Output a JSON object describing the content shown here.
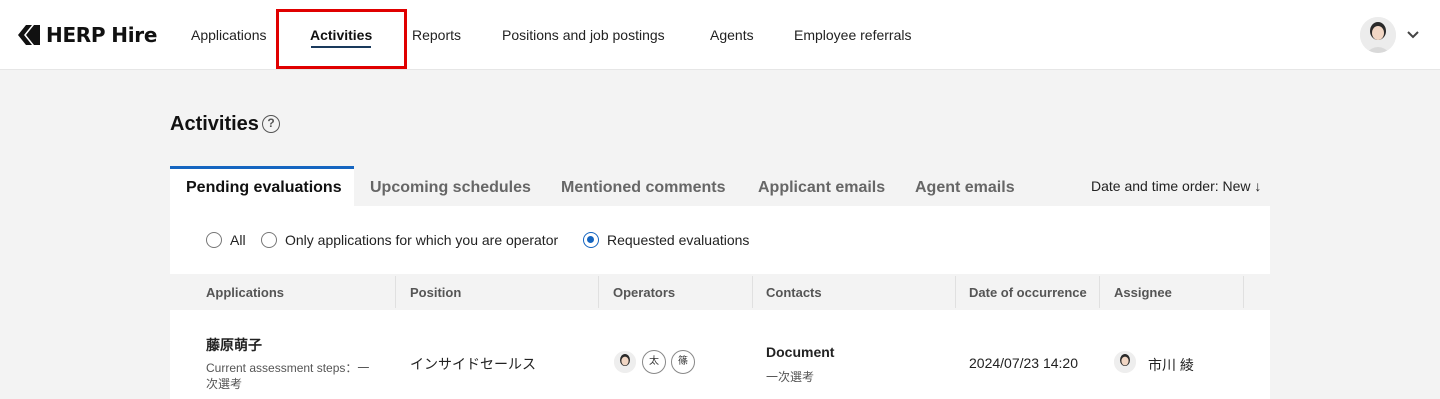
{
  "brand": {
    "name": "HERP",
    "product": "Hire"
  },
  "nav": {
    "items": [
      {
        "label": "Applications"
      },
      {
        "label": "Activities"
      },
      {
        "label": "Reports"
      },
      {
        "label": "Positions and job postings"
      },
      {
        "label": "Agents"
      },
      {
        "label": "Employee referrals"
      }
    ],
    "active": "Activities"
  },
  "page": {
    "title": "Activities",
    "help_symbol": "?"
  },
  "tabs": [
    {
      "label": "Pending evaluations"
    },
    {
      "label": "Upcoming schedules"
    },
    {
      "label": "Mentioned comments"
    },
    {
      "label": "Applicant emails"
    },
    {
      "label": "Agent emails"
    }
  ],
  "sort": {
    "label": "Date and time order: New ↓"
  },
  "filters": [
    {
      "label": "All",
      "checked": false
    },
    {
      "label": "Only applications for which you are operator",
      "checked": false
    },
    {
      "label": "Requested evaluations",
      "checked": true
    }
  ],
  "table": {
    "columns": [
      "Applications",
      "Position",
      "Operators",
      "Contacts",
      "Date of occurrence",
      "Assignee"
    ],
    "rows": [
      {
        "applicant_name": "藤原萌子",
        "step_line1": "Current assessment steps：一",
        "step_line2": "次選考",
        "position": "インサイドセールス",
        "operator_initials": [
          "太",
          "篠"
        ],
        "contact_title": "Document",
        "contact_sub": "一次選考",
        "date": "2024/07/23 14:20",
        "assignee": "市川 綾"
      }
    ]
  },
  "colors": {
    "accent": "#1565c0",
    "highlight": "#e00000",
    "nav_underline": "#1a3a5c"
  }
}
